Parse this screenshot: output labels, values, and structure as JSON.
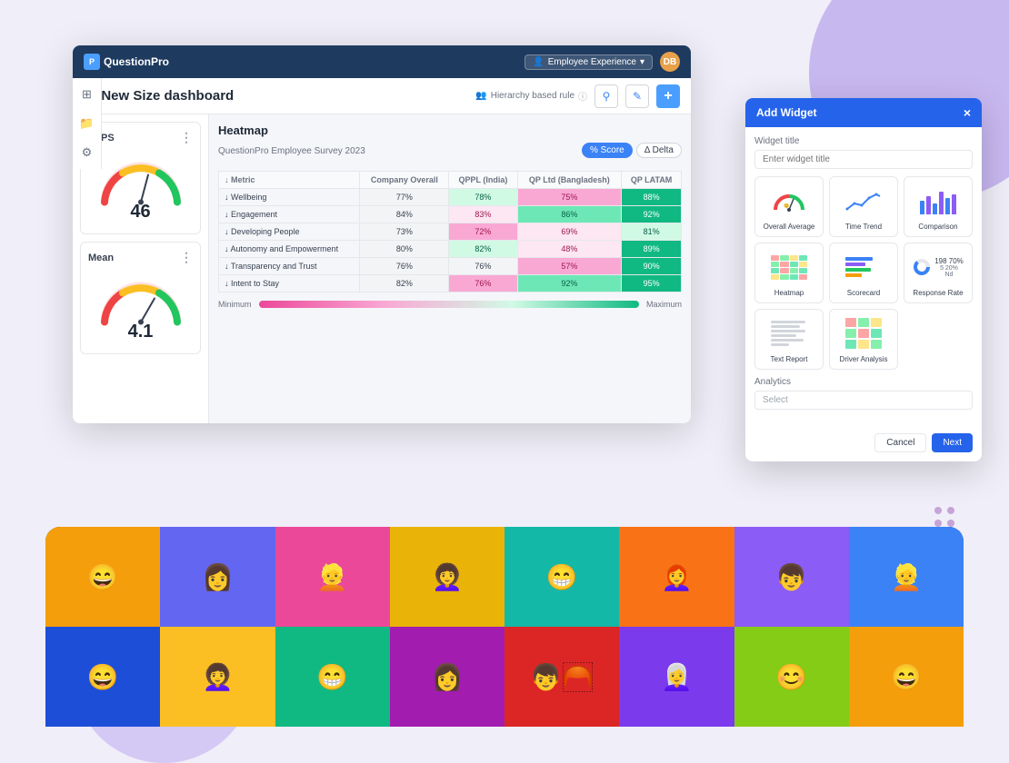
{
  "background": {
    "blob_colors": [
      "#c8b8f0",
      "#d4c8f5"
    ]
  },
  "nav": {
    "logo_text": "QuestionPro",
    "logo_icon": "P",
    "employee_btn": "Employee Experience",
    "avatar_initials": "DB"
  },
  "dashboard": {
    "title": "New Size dashboard",
    "breadcrumb": "Hierarchy based rule",
    "back_arrow": "‹"
  },
  "toolbar": {
    "filter_icon": "filter",
    "edit_icon": "edit",
    "add_icon": "+"
  },
  "widgets": {
    "enps": {
      "title": "eNPS",
      "value": "46"
    },
    "mean": {
      "title": "Mean",
      "value": "4.1"
    }
  },
  "heatmap": {
    "title": "Heatmap",
    "subtitle": "QuestionPro Employee Survey 2023",
    "btn_score": "% Score",
    "btn_delta": "Δ Delta",
    "columns": [
      "Metric",
      "Company Overall",
      "QPPL (India)",
      "QP Ltd (Bangladesh)",
      "QP LATAM"
    ],
    "rows": [
      {
        "metric": "Wellbeing",
        "company": "77%",
        "qppl": "78%",
        "qpltd": "75%",
        "latam": "88%",
        "colors": [
          "neutral",
          "green-light",
          "pink-med",
          "green-dark"
        ]
      },
      {
        "metric": "Engagement",
        "company": "84%",
        "qppl": "83%",
        "qpltd": "86%",
        "latam": "92%",
        "colors": [
          "neutral",
          "pink-light",
          "green-med",
          "green-dark"
        ]
      },
      {
        "metric": "Developing People",
        "company": "73%",
        "qppl": "72%",
        "qpltd": "69%",
        "latam": "81%",
        "colors": [
          "neutral",
          "pink-med",
          "pink",
          "green-light"
        ]
      },
      {
        "metric": "Autonomy and Empowerment",
        "company": "80%",
        "qppl": "82%",
        "qpltd": "48%",
        "latam": "89%",
        "colors": [
          "neutral",
          "green-light",
          "pink",
          "green-dark"
        ]
      },
      {
        "metric": "Transparency and Trust",
        "company": "76%",
        "qppl": "76%",
        "qpltd": "57%",
        "latam": "90%",
        "colors": [
          "neutral",
          "neutral",
          "pink-med",
          "green-dark"
        ]
      },
      {
        "metric": "Intent to Stay",
        "company": "82%",
        "qppl": "76%",
        "qpltd": "92%",
        "latam": "95%",
        "colors": [
          "neutral",
          "pink-med",
          "green-med",
          "green-dark"
        ]
      }
    ],
    "legend_min": "Minimum",
    "legend_max": "Maximum"
  },
  "add_widget": {
    "title": "Add Widget",
    "close": "×",
    "field_label": "Widget title",
    "field_placeholder": "Enter widget title",
    "widgets": [
      {
        "label": "Overall Average",
        "type": "gauge"
      },
      {
        "label": "Time Trend",
        "type": "trend"
      },
      {
        "label": "Comparison",
        "type": "comparison"
      },
      {
        "label": "Heatmap",
        "type": "heatmap"
      },
      {
        "label": "Scorecard",
        "type": "scorecard"
      },
      {
        "label": "Response Rate",
        "type": "response"
      },
      {
        "label": "Text Report",
        "type": "text"
      },
      {
        "label": "Driver Analysis",
        "type": "driver"
      }
    ],
    "analytics_label": "Analytics",
    "analytics_placeholder": "Select",
    "btn_cancel": "Cancel",
    "btn_next": "Next"
  },
  "people_colors": [
    "#f59e0b",
    "#6366f1",
    "#ec4899",
    "#84cc16",
    "#14b8a6",
    "#f97316",
    "#8b5cf6",
    "#ef4444",
    "#3b82f6",
    "#fbbf24",
    "#10b981",
    "#f43f5e",
    "#a855f7",
    "#06b6d4",
    "#84cc16",
    "#f59e0b"
  ]
}
